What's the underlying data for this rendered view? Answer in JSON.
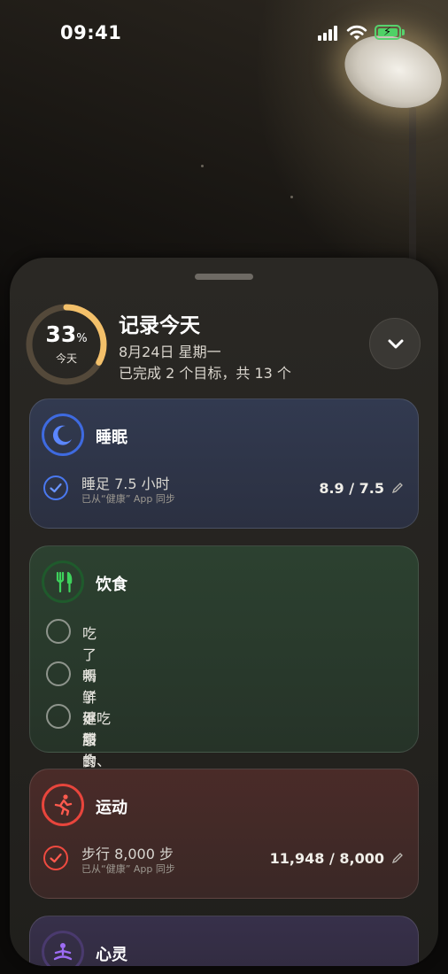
{
  "status_bar": {
    "time": "09:41"
  },
  "header": {
    "ring_percent": "33",
    "ring_percent_symbol": "%",
    "ring_fraction": 0.33,
    "ring_label": "今天",
    "title": "记录今天",
    "date": "8月24日 星期一",
    "progress_text": "已完成 2 个目标，共 13 个",
    "collapse_icon": "chevron-down-icon"
  },
  "categories": [
    {
      "name": "睡眠",
      "icon": "moon-icon",
      "color": "#3e6ae0",
      "items": [
        {
          "title": "睡足 7.5 小时",
          "subtitle": "已从“健康” App 同步",
          "value": "8.9 / 7.5",
          "checked": true
        }
      ]
    },
    {
      "name": "饮食",
      "icon": "fork-knife-icon",
      "color": "#2fb24a",
      "items": [
        {
          "title": "吃了新鲜健康的食物",
          "checked": false
        },
        {
          "title": "喝了足够的水",
          "checked": false
        },
        {
          "title": "不吃甜食、不喝含糖饮料",
          "checked": false
        }
      ]
    },
    {
      "name": "运动",
      "icon": "running-figure-icon",
      "color": "#e8453c",
      "items": [
        {
          "title": "步行 8,000 步",
          "subtitle": "已从“健康” App 同步",
          "value": "11,948 / 8,000",
          "checked": true
        }
      ]
    },
    {
      "name": "心灵",
      "icon": "meditation-icon",
      "color": "#8a5ae0"
    }
  ]
}
